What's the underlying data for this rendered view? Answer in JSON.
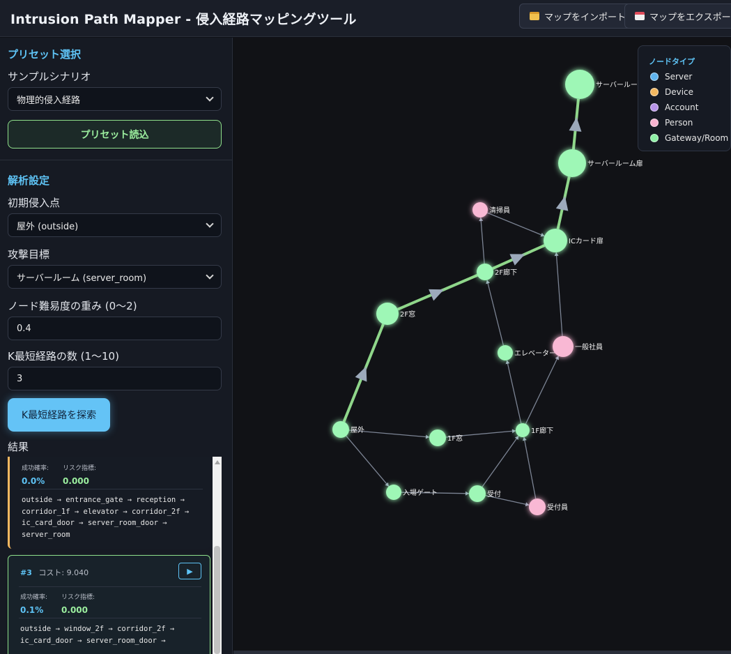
{
  "header": {
    "title": "Intrusion Path Mapper - 侵入経路マッピングツール",
    "import_label": "マップをインポート",
    "export_label": "マップをエクスポート"
  },
  "sidebar": {
    "preset_title": "プリセット選択",
    "scenario_label": "サンプルシナリオ",
    "scenario_value": "物理的侵入経路",
    "preset_button": "プリセット読込",
    "analysis_title": "解析設定",
    "entry_label": "初期侵入点",
    "entry_value": "屋外 (outside)",
    "target_label": "攻撃目標",
    "target_value": "サーバールーム (server_room)",
    "weight_label": "ノード難易度の重み (0〜2)",
    "weight_value": "0.4",
    "k_label": "K最短経路の数 (1〜10)",
    "k_value": "3",
    "search_button": "K最短経路を探索",
    "results_label": "結果"
  },
  "results": [
    {
      "success_label": "成功確率:",
      "success_value": "0.0%",
      "risk_label": "リスク指標:",
      "risk_value": "0.000",
      "path": "outside → entrance_gate → reception → corridor_1f → elevator → corridor_2f → ic_card_door → server_room_door → server_room"
    },
    {
      "rank": "#3",
      "cost": "コスト: 9.040",
      "success_label": "成功確率:",
      "success_value": "0.1%",
      "risk_label": "リスク指標:",
      "risk_value": "0.000",
      "path": "outside → window_2f → corridor_2f → ic_card_door → server_room_door →"
    }
  ],
  "legend": {
    "title": "ノードタイプ",
    "items": [
      {
        "label": "Server",
        "color": "#5fb4ee"
      },
      {
        "label": "Device",
        "color": "#f3b860"
      },
      {
        "label": "Account",
        "color": "#b794e8"
      },
      {
        "label": "Person",
        "color": "#f7b3d0"
      },
      {
        "label": "Gateway/Room",
        "color": "#8ef0a6"
      }
    ]
  },
  "graph": {
    "colors": {
      "gateway": "#9ef7b6",
      "person": "#f9b8d4",
      "edge": "#7c8494",
      "highlight": "#8fd68a",
      "arrow": "#9ca9bb"
    },
    "nodes": [
      {
        "id": "server_room",
        "label": "サーバールーム",
        "type": "gateway"
      },
      {
        "id": "server_room_door",
        "label": "サーバールーム扉",
        "type": "gateway"
      },
      {
        "id": "cleaner",
        "label": "清掃員",
        "type": "person"
      },
      {
        "id": "ic_card_door",
        "label": "ICカード扉",
        "type": "gateway"
      },
      {
        "id": "corridor_2f",
        "label": "2F廊下",
        "type": "gateway"
      },
      {
        "id": "window_2f",
        "label": "2F窓",
        "type": "gateway"
      },
      {
        "id": "elevator",
        "label": "エレベーター",
        "type": "gateway"
      },
      {
        "id": "employee",
        "label": "一般社員",
        "type": "person"
      },
      {
        "id": "outside",
        "label": "屋外",
        "type": "gateway"
      },
      {
        "id": "window_1f",
        "label": "1F窓",
        "type": "gateway"
      },
      {
        "id": "corridor_1f",
        "label": "1F廊下",
        "type": "gateway"
      },
      {
        "id": "entrance_gate",
        "label": "入場ゲート",
        "type": "gateway"
      },
      {
        "id": "reception",
        "label": "受付",
        "type": "gateway"
      },
      {
        "id": "receptionist",
        "label": "受付員",
        "type": "person"
      }
    ],
    "edges": [
      {
        "from": "outside",
        "to": "window_2f",
        "highlight": true
      },
      {
        "from": "window_2f",
        "to": "corridor_2f",
        "highlight": true
      },
      {
        "from": "corridor_2f",
        "to": "ic_card_door",
        "highlight": true
      },
      {
        "from": "ic_card_door",
        "to": "server_room_door",
        "highlight": true
      },
      {
        "from": "server_room_door",
        "to": "server_room",
        "highlight": true
      },
      {
        "from": "outside",
        "to": "window_1f",
        "highlight": false
      },
      {
        "from": "window_1f",
        "to": "corridor_1f",
        "highlight": false
      },
      {
        "from": "outside",
        "to": "entrance_gate",
        "highlight": false
      },
      {
        "from": "entrance_gate",
        "to": "reception",
        "highlight": false
      },
      {
        "from": "reception",
        "to": "receptionist",
        "highlight": false
      },
      {
        "from": "reception",
        "to": "corridor_1f",
        "highlight": false
      },
      {
        "from": "receptionist",
        "to": "corridor_1f",
        "highlight": false
      },
      {
        "from": "corridor_1f",
        "to": "elevator",
        "highlight": false
      },
      {
        "from": "elevator",
        "to": "corridor_2f",
        "highlight": false
      },
      {
        "from": "corridor_1f",
        "to": "employee",
        "highlight": false
      },
      {
        "from": "employee",
        "to": "ic_card_door",
        "highlight": false
      },
      {
        "from": "corridor_2f",
        "to": "cleaner",
        "highlight": false
      },
      {
        "from": "cleaner",
        "to": "ic_card_door",
        "highlight": false
      }
    ]
  }
}
